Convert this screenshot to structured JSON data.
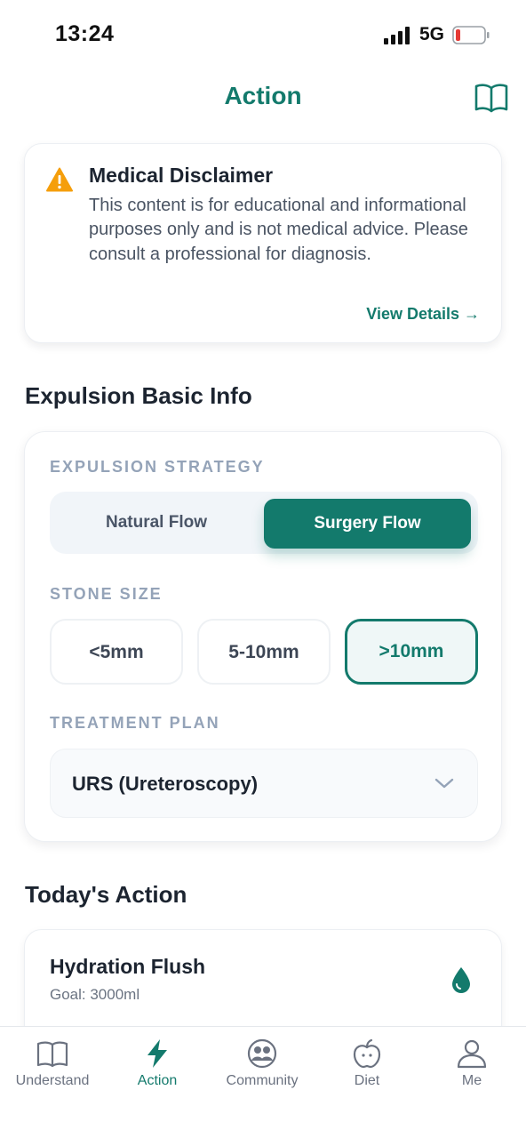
{
  "status_bar": {
    "time": "13:24",
    "network": "5G",
    "battery_level": 0.15
  },
  "header": {
    "title": "Action",
    "book_icon": "book-open-icon"
  },
  "disclaimer": {
    "icon": "warning-triangle-icon",
    "title": "Medical Disclaimer",
    "body": "This content is for educational and informational purposes only and is not medical advice. Please consult a professional for diagnosis.",
    "link_label": "View Details →"
  },
  "basic_info": {
    "section_title": "Expulsion Basic Info",
    "strategy_label": "EXPULSION STRATEGY",
    "strategy_options": [
      "Natural Flow",
      "Surgery Flow"
    ],
    "strategy_selected": "Surgery Flow",
    "stone_size_label": "STONE SIZE",
    "stone_sizes": [
      "<5mm",
      "5-10mm",
      ">10mm"
    ],
    "stone_size_selected": ">10mm",
    "plan_label": "TREATMENT PLAN",
    "plan_value": "URS (Ureteroscopy)"
  },
  "today": {
    "section_title": "Today's Action",
    "card_title": "Hydration Flush",
    "card_goal": "Goal: 3000ml",
    "card_icon": "water-drop-icon"
  },
  "nav": {
    "items": [
      {
        "label": "Understand",
        "icon": "book-icon"
      },
      {
        "label": "Action",
        "icon": "lightning-icon"
      },
      {
        "label": "Community",
        "icon": "people-icon"
      },
      {
        "label": "Diet",
        "icon": "apple-icon"
      },
      {
        "label": "Me",
        "icon": "person-icon"
      }
    ],
    "active": "Action"
  },
  "colors": {
    "accent": "#137a6c",
    "warning": "#f59e0b",
    "label_muted": "#94a3b8"
  }
}
